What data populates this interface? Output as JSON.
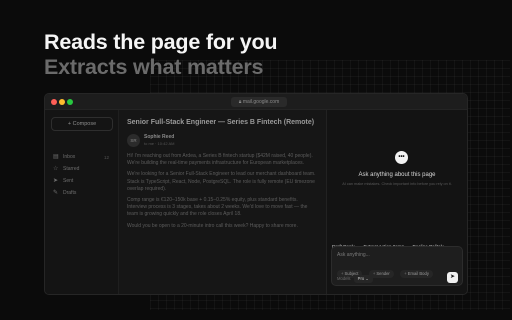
{
  "hero": {
    "line1": "Reads the page for you",
    "line2": "Extracts what matters"
  },
  "browser": {
    "url": "mail.google.com"
  },
  "sidebar": {
    "compose_label": "Compose",
    "items": [
      {
        "label": "Inbox",
        "icon": "inbox-icon",
        "count": "12"
      },
      {
        "label": "Starred",
        "icon": "star-icon",
        "count": ""
      },
      {
        "label": "Sent",
        "icon": "send-icon",
        "count": ""
      },
      {
        "label": "Drafts",
        "icon": "draft-icon",
        "count": ""
      }
    ]
  },
  "email": {
    "subject": "Senior Full-Stack Engineer — Series B Fintech (Remote)",
    "sender_initials": "SR",
    "sender_name": "Sophie Reed",
    "sender_meta": "to me · 10:42 AM",
    "paragraphs": [
      "Hi! I'm reaching out from Ardea, a Series B fintech startup ($42M raised, 40 people). We're building the real-time payments infrastructure for European marketplaces.",
      "We're looking for a Senior Full-Stack Engineer to lead our merchant dashboard team. Stack is TypeScript, React, Node, PostgreSQL. The role is fully remote (EU timezone overlap required).",
      "Comp range is €120–150k base + 0.15–0.25% equity, plus standard benefits. Interview process is 3 stages, takes about 2 weeks. We'd love to move fast — the team is growing quickly and the role closes April 18.",
      "Would you be open to a 20-minute intro call this week? Happy to share more."
    ]
  },
  "assistant": {
    "title": "Ask anything about this page",
    "subtitle": "AI can make mistakes. Check important info before you rely on it.",
    "actions": [
      "Draft Reply",
      "Extract Action Items",
      "Decline Politely"
    ],
    "input_placeholder": "Ask anything...",
    "chips": [
      "Subject",
      "Sender",
      "Email Body"
    ],
    "model_label": "Models",
    "model_value": "Pro"
  }
}
